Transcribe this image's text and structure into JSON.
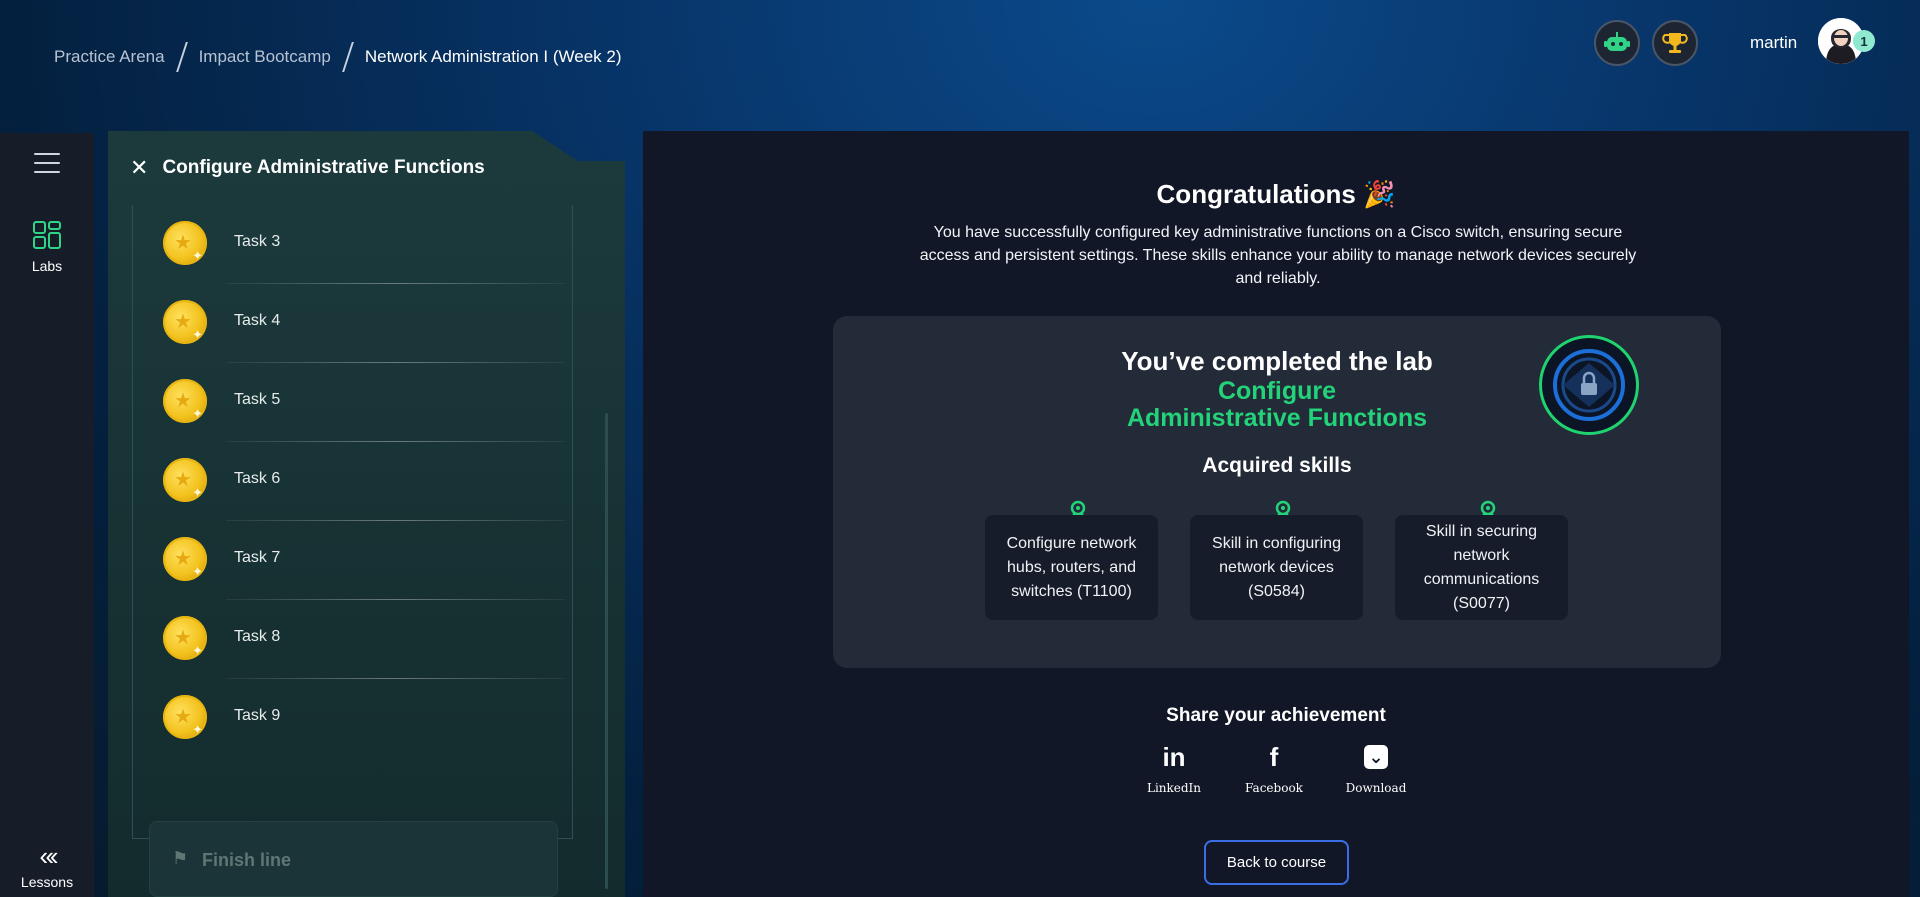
{
  "breadcrumb": {
    "items": [
      "Practice Arena",
      "Impact Bootcamp",
      "Network Administration I (Week 2)"
    ]
  },
  "header": {
    "username": "martin",
    "notification_count": "1",
    "icons": [
      "robot-icon",
      "trophy-icon"
    ]
  },
  "rail": {
    "labs_label": "Labs",
    "lessons_label": "Lessons",
    "lessons_glyph": "«‹"
  },
  "panel": {
    "title": "Configure Administrative Functions",
    "tasks": [
      "Task 3",
      "Task 4",
      "Task 5",
      "Task 6",
      "Task 7",
      "Task 8",
      "Task 9"
    ],
    "finish_label": "Finish line"
  },
  "main": {
    "congrats_title": "Congratulations 🎉",
    "description": "You have successfully configured key administrative functions on a Cisco switch, ensuring secure access and persistent settings. These skills enhance your ability to manage network devices securely and reliably.",
    "completed_text": "You’ve completed the lab",
    "lab_name_line1": "Configure",
    "lab_name_line2": "Administrative Functions",
    "acquired_title": "Acquired skills",
    "skills": [
      "Configure network hubs, routers, and switches (T1100)",
      "Skill in configuring network devices (S0584)",
      "Skill in securing network communications (S0077)"
    ],
    "share_title": "Share your achievement",
    "share_items": [
      "LinkedIn",
      "Facebook",
      "Download"
    ],
    "share_glyphs": [
      "in",
      "f",
      "⌄"
    ],
    "back_button": "Back to course"
  },
  "colors": {
    "accent_green": "#23d37a",
    "button_border": "#3b6ee6",
    "coin_gold": "#f2c11c"
  }
}
